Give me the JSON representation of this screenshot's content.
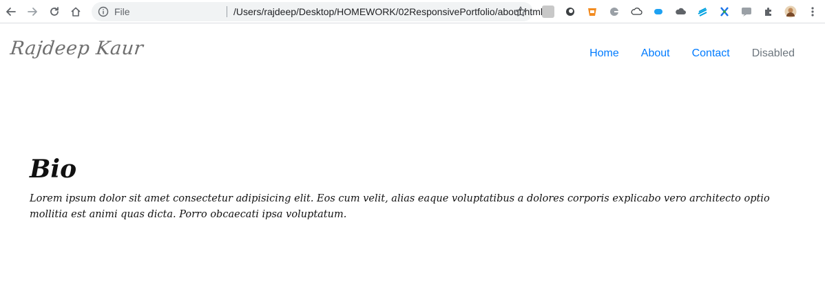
{
  "browser": {
    "url_scheme": "File",
    "url": "/Users/rajdeep/Desktop/HOMEWORK/02ResponsivePortfolio/about.html",
    "icons": {
      "back": "arrow-left-icon",
      "forward": "arrow-right-icon",
      "reload": "reload-icon",
      "home": "home-icon",
      "info": "info-icon",
      "bookmark": "star-icon",
      "extensions": "puzzle-icon",
      "menu": "kebab-menu-icon"
    }
  },
  "site": {
    "brand": "Rajdeep Kaur",
    "nav": [
      {
        "label": "Home"
      },
      {
        "label": "About"
      },
      {
        "label": "Contact"
      },
      {
        "label": "Disabled"
      }
    ]
  },
  "bio": {
    "title": "Bio",
    "text": "Lorem ipsum dolor sit amet consectetur adipisicing elit. Eos cum velit, alias eaque voluptatibus a dolores corporis explicabo vero architecto optio mollitia est animi quas dicta. Porro obcaecati ipsa voluptatum."
  },
  "colors": {
    "link": "#007bff",
    "disabled": "#6c757d",
    "brand": "#6f6f6f"
  }
}
